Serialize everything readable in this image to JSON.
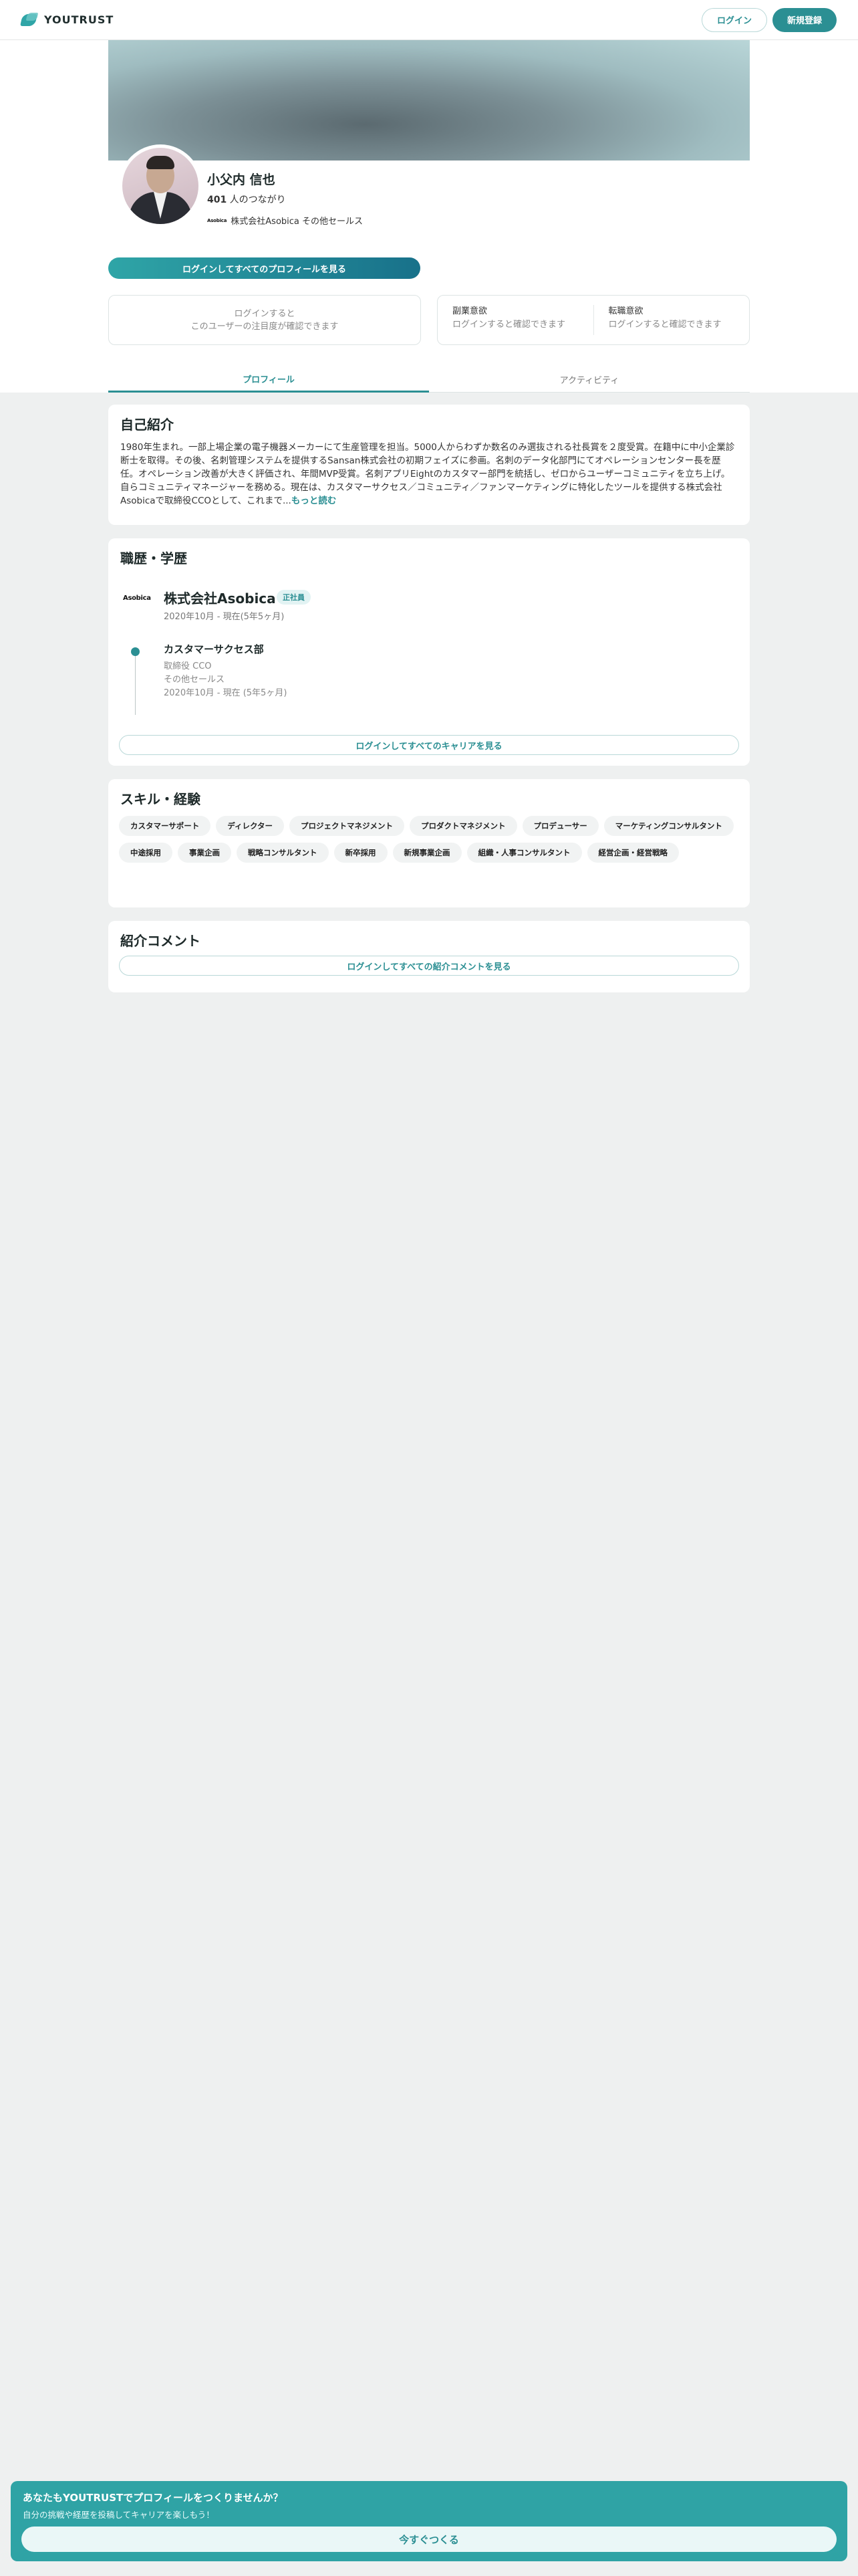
{
  "header": {
    "logo_text": "YOUTRUST",
    "login_label": "ログイン",
    "signup_label": "新規登録"
  },
  "profile": {
    "name": "小父内 信也",
    "connections_count": "401",
    "connections_suffix": " 人のつながり",
    "company_logo_text": "Asobica",
    "company_line": "株式会社Asobica その他セールス",
    "cta_label": "ログインしてすべてのプロフィールを見る",
    "attention_line1": "ログインすると",
    "attention_line2": "このユーザーの注目度が確認できます",
    "side_job_title": "副業意欲",
    "side_job_value": "ログインすると確認できます",
    "job_change_title": "転職意欲",
    "job_change_value": "ログインすると確認できます"
  },
  "tabs": [
    {
      "label": "プロフィール",
      "active": true
    },
    {
      "label": "アクティビティ",
      "active": false
    }
  ],
  "intro": {
    "title": "自己紹介",
    "text": "1980年生まれ。一部上場企業の電子機器メーカーにて生産管理を担当。5000人からわずか数名のみ選抜される社長賞を２度受賞。在籍中に中小企業診断士を取得。その後、名刺管理システムを提供するSansan株式会社の初期フェイズに参画。名刺のデータ化部門にてオペレーションセンター長を歴任。オペレーション改善が大きく評価され、年間MVP受賞。名刺アプリEightのカスタマー部門を統括し、ゼロからユーザーコミュニティを立ち上げ。自らコミュニティマネージャーを務める。現在は、カスタマーサクセス／コミュニティ／ファンマーケティングに特化したツールを提供する株式会社Asobicaで取締役CCOとして、これまで...",
    "more_label": "もっと読む"
  },
  "career": {
    "title": "職歴・学歴",
    "company_logo_text": "Asobica",
    "company_name": "株式会社Asobica",
    "badge": "正社員",
    "period": "2020年10月 - 現在(5年5ヶ月)",
    "department": "カスタマーサクセス部",
    "role": "取締役 CCO",
    "job_type": "その他セールス",
    "dept_period": "2020年10月 - 現在 (5年5ヶ月)",
    "cta_label": "ログインしてすべてのキャリアを見る"
  },
  "skills": {
    "title": "スキル・経験",
    "items": [
      "カスタマーサポート",
      "ディレクター",
      "プロジェクトマネジメント",
      "プロダクトマネジメント",
      "プロデューサー",
      "マーケティングコンサルタント",
      "中途採用",
      "事業企画",
      "戦略コンサルタント",
      "新卒採用",
      "新規事業企画",
      "組織・人事コンサルタント",
      "経営企画・経営戦略"
    ]
  },
  "comments": {
    "title": "紹介コメント",
    "cta_label": "ログインしてすべての紹介コメントを見る"
  },
  "banner": {
    "title": "あなたもYOUTRUSTでプロフィールをつくりませんか？",
    "subtitle": "自分の挑戦や経歴を投稿してキャリアを楽しもう！",
    "button_label": "今すぐつくる"
  },
  "colors": {
    "accent": "#2b8f93",
    "banner": "#2fa3a5",
    "background": "#eef0f0"
  }
}
